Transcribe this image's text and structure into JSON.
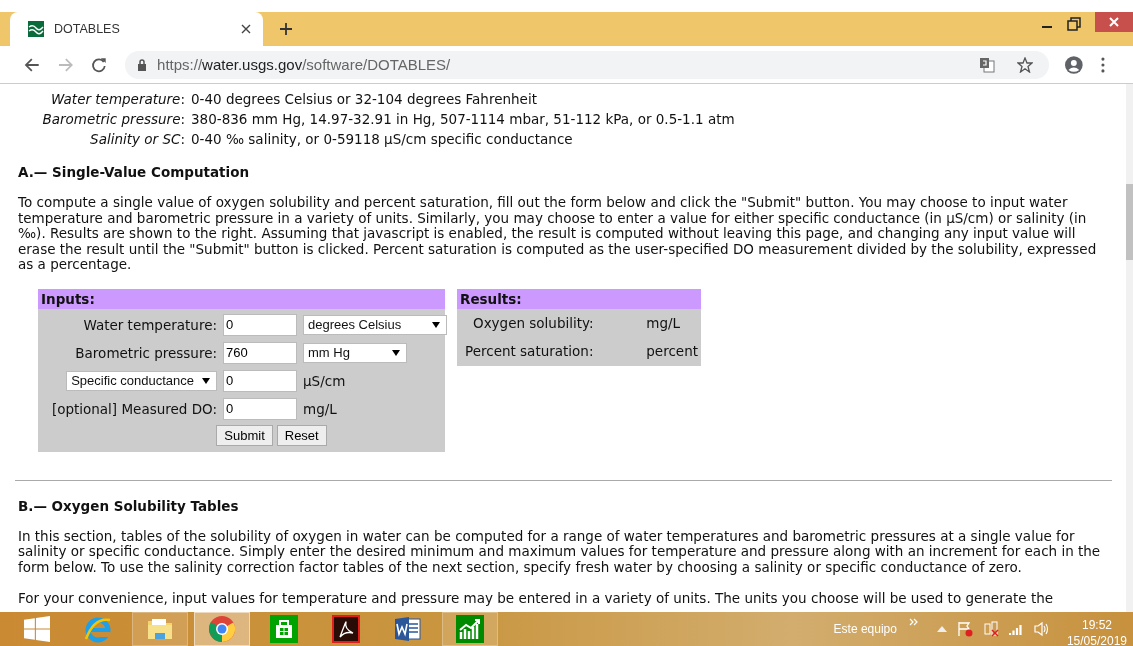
{
  "browser": {
    "tab_title": "DOTABLES",
    "url": {
      "scheme": "https://",
      "host": "water.usgs.gov",
      "path": "/software/DOTABLES/"
    }
  },
  "ranges": [
    {
      "label": "*Water temperature*:",
      "value": "0-40 degrees Celsius or 32-104 degrees Fahrenheit"
    },
    {
      "label": "*Barometric pressure*:",
      "value": "380-836 mm Hg, 14.97-32.91 in Hg, 507-1114 mbar, 51-112 kPa, or 0.5-1.1 atm"
    },
    {
      "label": "*Salinity or SC*:",
      "value": "0-40 ‰ salinity, or 0-59118 µS/cm specific conductance"
    }
  ],
  "section_a": {
    "heading": "A.— Single-Value Computation",
    "paragraph": "To compute a single value of oxygen solubility and percent saturation, fill out the form below and click the \"Submit\" button. You may choose to input water temperature and barometric pressure in a variety of units. Similarly, you may choose to enter a value for either specific conductance (in µS/cm) or salinity (in ‰). Results are shown to the right. Assuming that javascript is enabled, the result is computed without leaving this page, and changing any input value will erase the result until the \"Submit\" button is clicked. Percent saturation is computed as the user-specified DO measurement divided by the solubility, expressed as a percentage.",
    "inputs": {
      "title": "Inputs:",
      "rows": [
        {
          "label": {
            "kind": "text",
            "text": "Water temperature:"
          },
          "value": "0",
          "unit": {
            "kind": "select",
            "text": "degrees Celsius"
          }
        },
        {
          "label": {
            "kind": "text",
            "text": "Barometric pressure:"
          },
          "value": "760",
          "unit": {
            "kind": "select",
            "text": "mm Hg"
          }
        },
        {
          "label": {
            "kind": "select",
            "text": "Specific conductance"
          },
          "value": "0",
          "unit": {
            "kind": "text",
            "text": "µS/cm"
          }
        },
        {
          "label": {
            "kind": "text",
            "text": "[optional] Measured DO:"
          },
          "value": "0",
          "unit": {
            "kind": "text",
            "text": "mg/L"
          }
        }
      ],
      "buttons": [
        "Submit",
        "Reset"
      ]
    },
    "results": {
      "title": "Results:",
      "rows": [
        {
          "label": "Oxygen solubility:",
          "unit": "mg/L"
        },
        {
          "label": "Percent saturation:",
          "unit": "percent"
        }
      ]
    }
  },
  "section_b": {
    "heading": "B.— Oxygen Solubility Tables",
    "paragraphs": [
      "In this section, tables of the solubility of oxygen in water can be computed for a range of water temperatures and barometric pressures at a single value for salinity or specific conductance. Simply enter the desired minimum and maximum values for temperature and pressure along with an increment for each in the form below. To use the salinity correction factor tables of the next section, specify fresh water by choosing a salinity or specific conductance of zero.",
      "For your convenience, input values for temperature and pressure may be entered in a variety of units. The units you choose will be used to generate the"
    ]
  },
  "taskbar": {
    "apps": [
      {
        "kind": "ie",
        "running": false,
        "selected": false
      },
      {
        "kind": "folder",
        "running": true,
        "selected": false
      },
      {
        "kind": "chrome",
        "running": true,
        "selected": true
      },
      {
        "kind": "store",
        "running": false,
        "selected": false
      },
      {
        "kind": "pdf",
        "running": false,
        "selected": false
      },
      {
        "kind": "word",
        "running": false,
        "selected": false
      },
      {
        "kind": "chart",
        "running": true,
        "selected": false
      }
    ],
    "location": "Este equipo",
    "time": "19:52",
    "date": "15/05/2019"
  }
}
